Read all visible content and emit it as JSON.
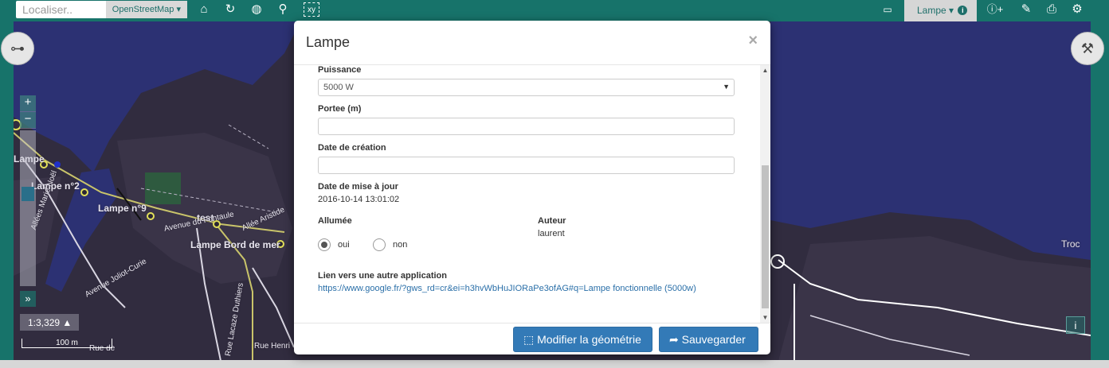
{
  "toolbar": {
    "search_placeholder": "Localiser..",
    "base_layer": "OpenStreetMap ▾",
    "active_layer": "Lampe ▾",
    "icons": [
      "home-icon",
      "refresh-icon",
      "globe-icon",
      "marker-icon",
      "xy-icon",
      "ruler-icon",
      "layer-info-icon",
      "info-add-icon",
      "edit-icon",
      "print-icon",
      "settings-icon"
    ]
  },
  "map": {
    "labels": [
      "Lampe",
      "Lampe n°2",
      "Lampe n°9",
      "test",
      "Lampe Bord de mer",
      "Allées Marie Noël",
      "Avenue Joliot-Curie",
      "Avenue du Fontaule",
      "Allée Aristide",
      "Rue Lacaze Duthiers",
      "Rue Henri",
      "Rue de",
      "Troc"
    ],
    "zoom_in": "+",
    "zoom_out": "−",
    "expand": "»",
    "scale": "1:3,329 ▲",
    "scale_bar": "100 m",
    "info": "i"
  },
  "modal": {
    "title": "Lampe",
    "close": "×",
    "fields": {
      "puissance_label": "Puissance",
      "puissance_value": "5000 W",
      "portee_label": "Portee (m)",
      "creation_label": "Date de création",
      "maj_label": "Date de mise à jour",
      "maj_value": "2016-10-14 13:01:02",
      "allumee_label": "Allumée",
      "oui": "oui",
      "non": "non",
      "auteur_label": "Auteur",
      "auteur_value": "laurent",
      "lien_label": "Lien vers une autre application",
      "lien_value": "https://www.google.fr/?gws_rd=cr&ei=h3hvWbHuJIORaPe3ofAG#q=Lampe fonctionnelle (5000w)"
    },
    "buttons": {
      "modify": "Modifier la géométrie",
      "save": "Sauvegarder"
    }
  },
  "colors": {
    "toolbar": "#17736a",
    "map_bg": "#312c3f",
    "water": "#2c3173",
    "primary": "#337ab7"
  }
}
